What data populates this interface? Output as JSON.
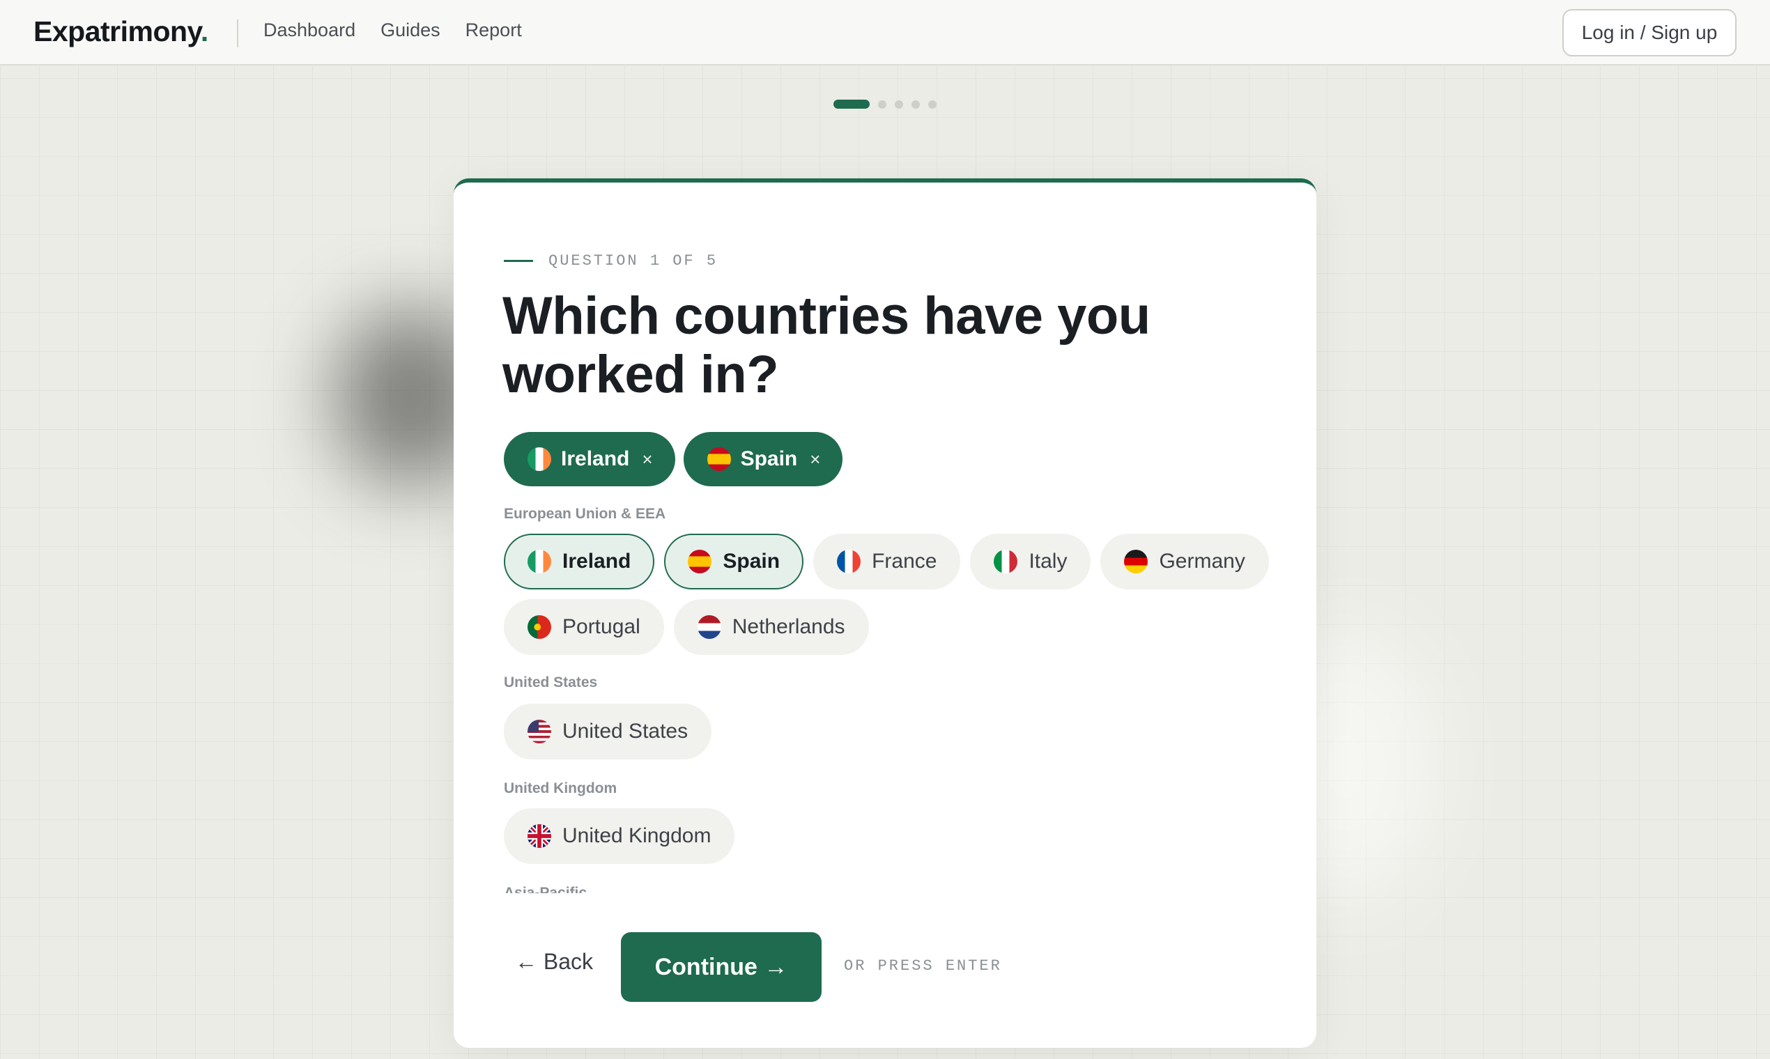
{
  "header": {
    "logo": "Expatrimony",
    "logo_dot": ".",
    "nav": [
      "Dashboard",
      "Guides",
      "Report"
    ],
    "login_label": "Log in / Sign up"
  },
  "progress": {
    "current_step": 1,
    "total_steps": 5
  },
  "question": {
    "label": "QUESTION 1 OF 5",
    "title": "Which countries have you worked in?"
  },
  "selected": [
    {
      "name": "Ireland",
      "flag": "ireland-flag-icon",
      "remove": "×"
    },
    {
      "name": "Spain",
      "flag": "spain-flag-icon",
      "remove": "×"
    }
  ],
  "groups": [
    {
      "label": "European Union & EEA",
      "countries": [
        {
          "name": "Ireland",
          "flag": "ireland-flag-icon",
          "selected": true
        },
        {
          "name": "Spain",
          "flag": "spain-flag-icon",
          "selected": true
        },
        {
          "name": "France",
          "flag": "france-flag-icon",
          "selected": false
        },
        {
          "name": "Italy",
          "flag": "italy-flag-icon",
          "selected": false
        },
        {
          "name": "Germany",
          "flag": "germany-flag-icon",
          "selected": false
        },
        {
          "name": "Portugal",
          "flag": "portugal-flag-icon",
          "selected": false
        },
        {
          "name": "Netherlands",
          "flag": "netherlands-flag-icon",
          "selected": false
        }
      ]
    },
    {
      "label": "United States",
      "countries": [
        {
          "name": "United States",
          "flag": "united-states-flag-icon",
          "selected": false
        }
      ]
    },
    {
      "label": "United Kingdom",
      "countries": [
        {
          "name": "United Kingdom",
          "flag": "united-kingdom-flag-icon",
          "selected": false
        }
      ]
    },
    {
      "label": "Asia-Pacific",
      "countries": []
    }
  ],
  "actions": {
    "back_label": "← Back",
    "continue_label": "Continue →",
    "enter_hint": "OR PRESS ENTER"
  },
  "colors": {
    "accent": "#1e6b4f",
    "background": "#ecece6",
    "chip_bg": "#f1f1ed",
    "chip_selected_bg": "#e6f0eb"
  }
}
